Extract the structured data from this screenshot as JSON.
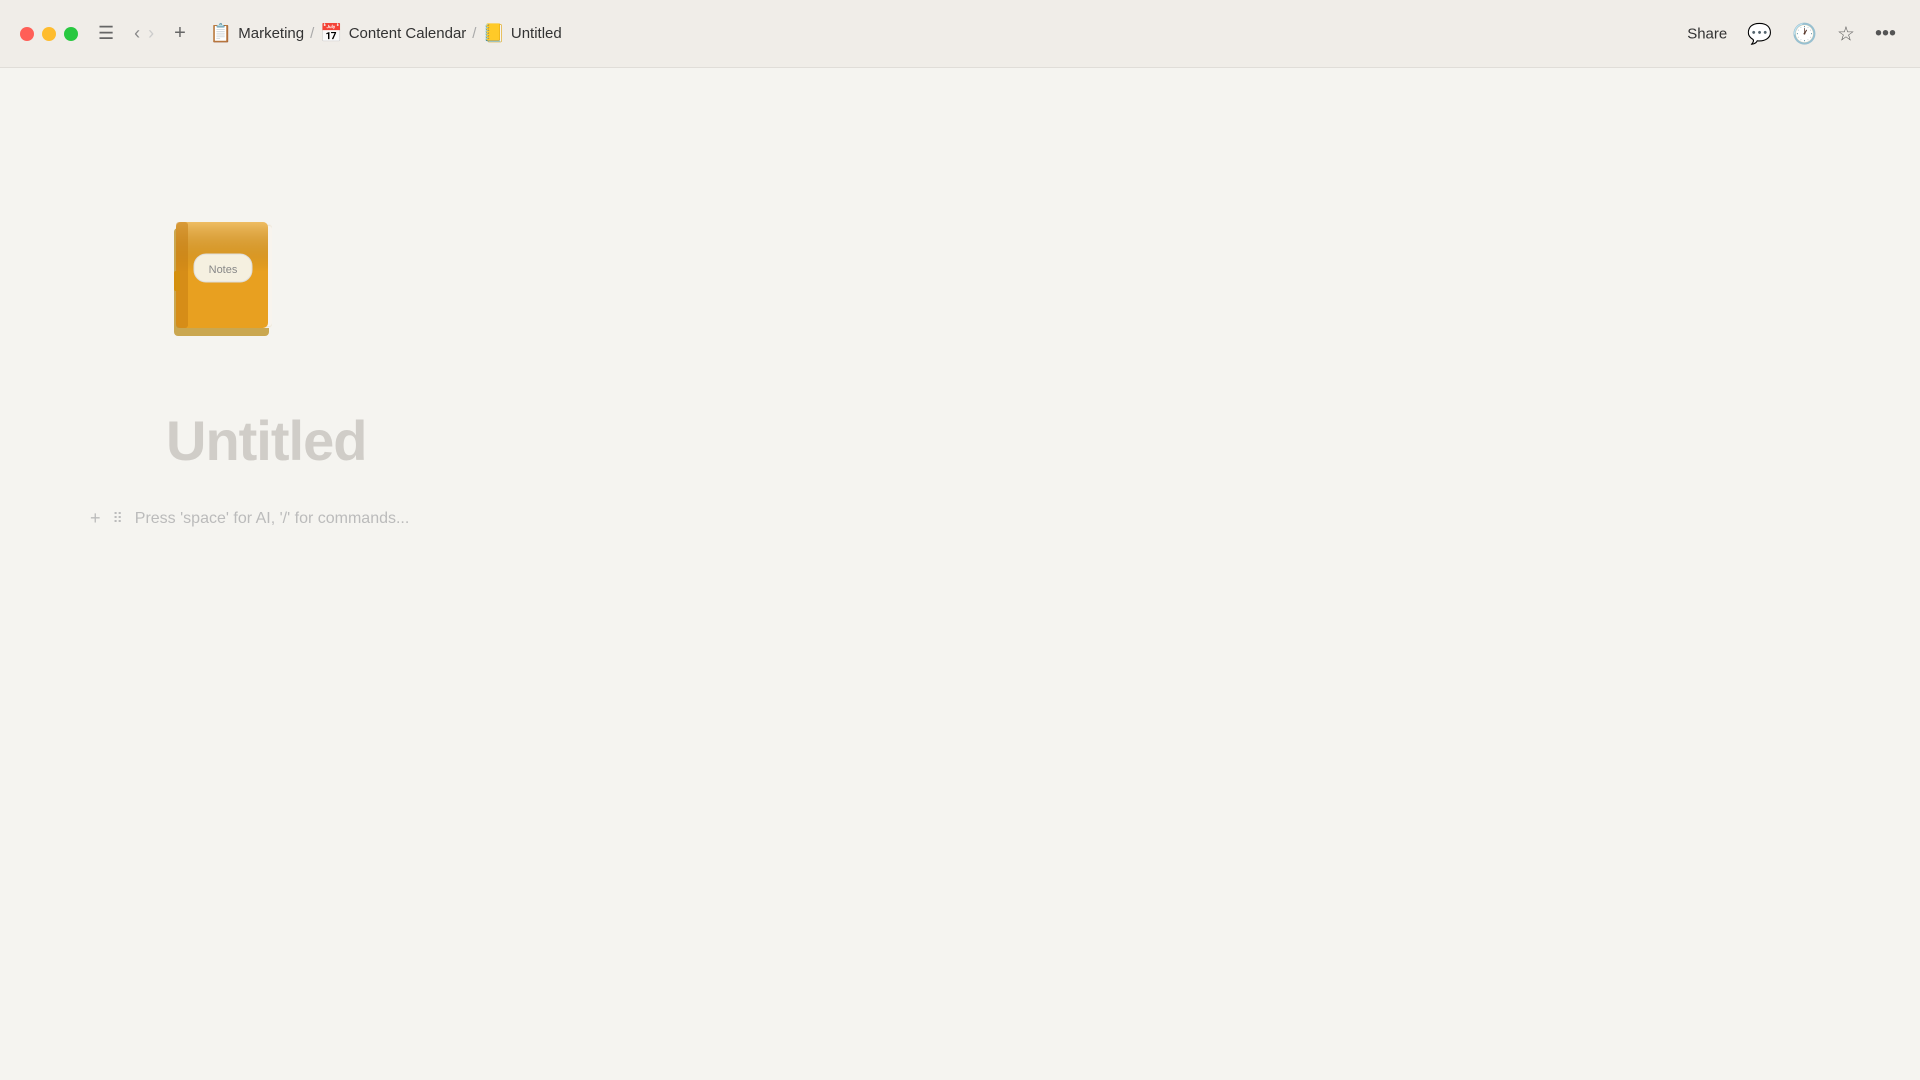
{
  "titlebar": {
    "breadcrumb": [
      {
        "icon": "📋",
        "label": "Marketing"
      },
      {
        "icon": "📅",
        "label": "Content Calendar"
      },
      {
        "icon": "📒",
        "label": "Untitled"
      }
    ],
    "share_label": "Share",
    "nav": {
      "back_disabled": false,
      "forward_disabled": true
    }
  },
  "page": {
    "title": "Untitled",
    "placeholder": "Press 'space' for AI, '/' for commands..."
  },
  "icons": {
    "hamburger": "☰",
    "back_arrow": "‹",
    "forward_arrow": "›",
    "plus": "+",
    "separator": "/",
    "comment": "💬",
    "history": "🕐",
    "star": "☆",
    "more": "•••",
    "add_block": "+",
    "drag_handle": "⠿"
  }
}
